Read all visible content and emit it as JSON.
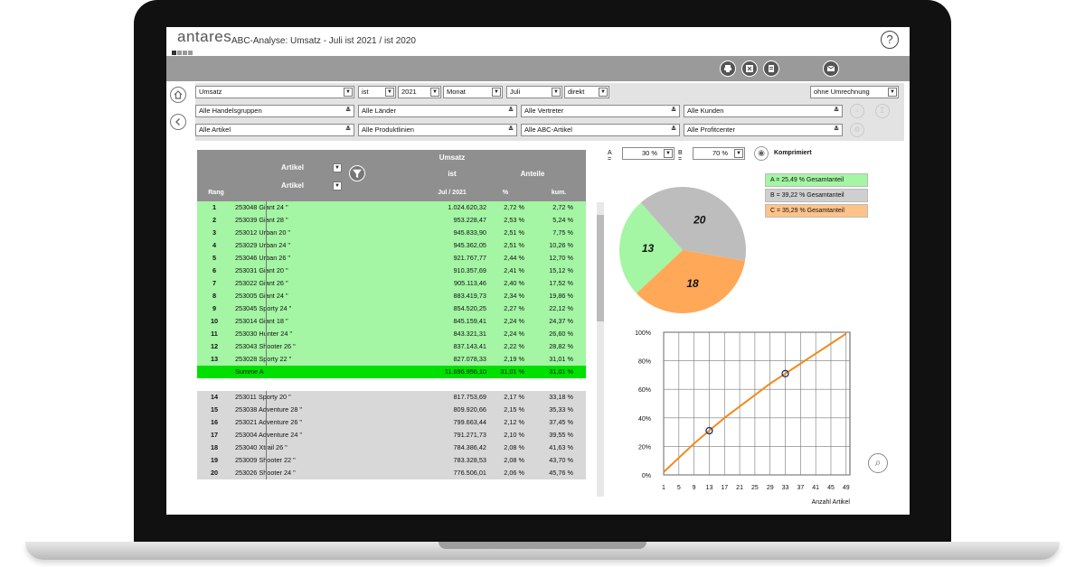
{
  "header": {
    "logo_text": "antares",
    "title": "ABC-Analyse: Umsatz - Juli  ist 2021 / ist 2020",
    "help_label": "?"
  },
  "toolbar": {
    "icons": [
      "print-icon",
      "excel-icon",
      "pdf-icon",
      "mail-icon"
    ]
  },
  "filters": {
    "row1": [
      "Umsatz",
      "ist",
      "2021",
      "Monat",
      "Juli",
      "direkt"
    ],
    "conversion": "ohne Umrechnung",
    "row2": [
      "Alle Handelsgruppen",
      "Alle Länder",
      "Alle Vertreter",
      "Alle Kunden"
    ],
    "row3": [
      "Alle Artikel",
      "Alle Produktlinien",
      "Alle ABC-Artikel",
      "Alle Profitcenter"
    ]
  },
  "table": {
    "header_umsatz": "Umsatz",
    "header_ist": "ist",
    "header_anteile": "Anteile",
    "header_artikel_select": "Artikel",
    "header_artikel": "Artikel",
    "col_rang": "Rang",
    "col_period": "Jul / 2021",
    "col_pct": "%",
    "col_kum": "kum.",
    "rows_a": [
      {
        "rang": "1",
        "artikel": "253048 Giant 24 \"",
        "umsatz": "1.024.620,32",
        "pct": "2,72 %",
        "kum": "2,72 %"
      },
      {
        "rang": "2",
        "artikel": "253039 Giant 28 \"",
        "umsatz": "953.228,47",
        "pct": "2,53 %",
        "kum": "5,24 %"
      },
      {
        "rang": "3",
        "artikel": "253012 Urban 20 \"",
        "umsatz": "945.833,90",
        "pct": "2,51 %",
        "kum": "7,75 %"
      },
      {
        "rang": "4",
        "artikel": "253029 Urban 24 \"",
        "umsatz": "945.362,05",
        "pct": "2,51 %",
        "kum": "10,26 %"
      },
      {
        "rang": "5",
        "artikel": "253046 Urban 26 \"",
        "umsatz": "921.767,77",
        "pct": "2,44 %",
        "kum": "12,70 %"
      },
      {
        "rang": "6",
        "artikel": "253031 Giant 20 \"",
        "umsatz": "910.357,69",
        "pct": "2,41 %",
        "kum": "15,12 %"
      },
      {
        "rang": "7",
        "artikel": "253022 Giant 26 \"",
        "umsatz": "905.113,46",
        "pct": "2,40 %",
        "kum": "17,52 %"
      },
      {
        "rang": "8",
        "artikel": "253005 Giant 24 \"",
        "umsatz": "883.419,73",
        "pct": "2,34 %",
        "kum": "19,86 %"
      },
      {
        "rang": "9",
        "artikel": "253045 Sporty 24 \"",
        "umsatz": "854.520,25",
        "pct": "2,27 %",
        "kum": "22,12 %"
      },
      {
        "rang": "10",
        "artikel": "253014 Giant 18 \"",
        "umsatz": "845.159,41",
        "pct": "2,24 %",
        "kum": "24,37 %"
      },
      {
        "rang": "11",
        "artikel": "253030 Hunter 24 \"",
        "umsatz": "843.321,31",
        "pct": "2,24 %",
        "kum": "26,60 %"
      },
      {
        "rang": "12",
        "artikel": "253043 Shooter 26 \"",
        "umsatz": "837.143,41",
        "pct": "2,22 %",
        "kum": "28,82 %"
      },
      {
        "rang": "13",
        "artikel": "253028 Sporty 22 \"",
        "umsatz": "827.078,33",
        "pct": "2,19 %",
        "kum": "31,01 %"
      }
    ],
    "summe_a": {
      "label": "Summe A",
      "umsatz": "11.696.956,10",
      "pct": "31,01 %",
      "kum": "31,01 %"
    },
    "rows_b": [
      {
        "rang": "14",
        "artikel": "253011 Sporty 20 \"",
        "umsatz": "817.753,69",
        "pct": "2,17 %",
        "kum": "33,18 %"
      },
      {
        "rang": "15",
        "artikel": "253038 Adventure 28 \"",
        "umsatz": "809.920,66",
        "pct": "2,15 %",
        "kum": "35,33 %"
      },
      {
        "rang": "16",
        "artikel": "253021 Adventure 26 \"",
        "umsatz": "799.663,44",
        "pct": "2,12 %",
        "kum": "37,45 %"
      },
      {
        "rang": "17",
        "artikel": "253004 Adventure 24 \"",
        "umsatz": "791.271,73",
        "pct": "2,10 %",
        "kum": "39,55 %"
      },
      {
        "rang": "18",
        "artikel": "253040 Xtrail 26 \"",
        "umsatz": "784.386,42",
        "pct": "2,08 %",
        "kum": "41,63 %"
      },
      {
        "rang": "19",
        "artikel": "253009 Shooter 22 \"",
        "umsatz": "783.328,53",
        "pct": "2,08 %",
        "kum": "43,70 %"
      },
      {
        "rang": "20",
        "artikel": "253026 Shooter 24 \"",
        "umsatz": "776.506,01",
        "pct": "2,06 %",
        "kum": "45,76 %"
      }
    ]
  },
  "abc_settings": {
    "a_label": "A =",
    "a_value": "30 %",
    "b_label": "B =",
    "b_value": "70 %",
    "compressed_label": "Komprimiert"
  },
  "legend": [
    {
      "text": "A  = 25,49 % Gesamtanteil",
      "color": "#a4f5a4"
    },
    {
      "text": "B  = 39,22 % Gesamtanteil",
      "color": "#cfcfcf"
    },
    {
      "text": "C  = 35,29 % Gesamtanteil",
      "color": "#ffc389"
    }
  ],
  "chart_data": [
    {
      "type": "pie",
      "slices": [
        {
          "label": "13",
          "value": 13,
          "color": "#a4f5a4"
        },
        {
          "label": "20",
          "value": 20,
          "color": "#bdbdbd"
        },
        {
          "label": "18",
          "value": 18,
          "color": "#ffa857"
        }
      ]
    },
    {
      "type": "line",
      "x": [
        1,
        5,
        9,
        13,
        17,
        21,
        25,
        29,
        33,
        37,
        41,
        45,
        49
      ],
      "y": [
        2,
        12,
        22,
        31,
        40,
        48,
        56,
        64,
        71,
        78,
        85,
        92,
        99
      ],
      "markers": [
        {
          "x": 13,
          "y": 31
        },
        {
          "x": 33,
          "y": 71
        }
      ],
      "xlabel": "Anzahl Artikel",
      "ylabel": "",
      "x_ticks": [
        "1",
        "5",
        "9",
        "13",
        "17",
        "21",
        "25",
        "29",
        "33",
        "37",
        "41",
        "45",
        "49"
      ],
      "y_ticks": [
        "0%",
        "20%",
        "40%",
        "60%",
        "80%",
        "100%"
      ],
      "ylim": [
        0,
        100
      ],
      "grid": true,
      "line_color": "#f28a1f"
    }
  ]
}
